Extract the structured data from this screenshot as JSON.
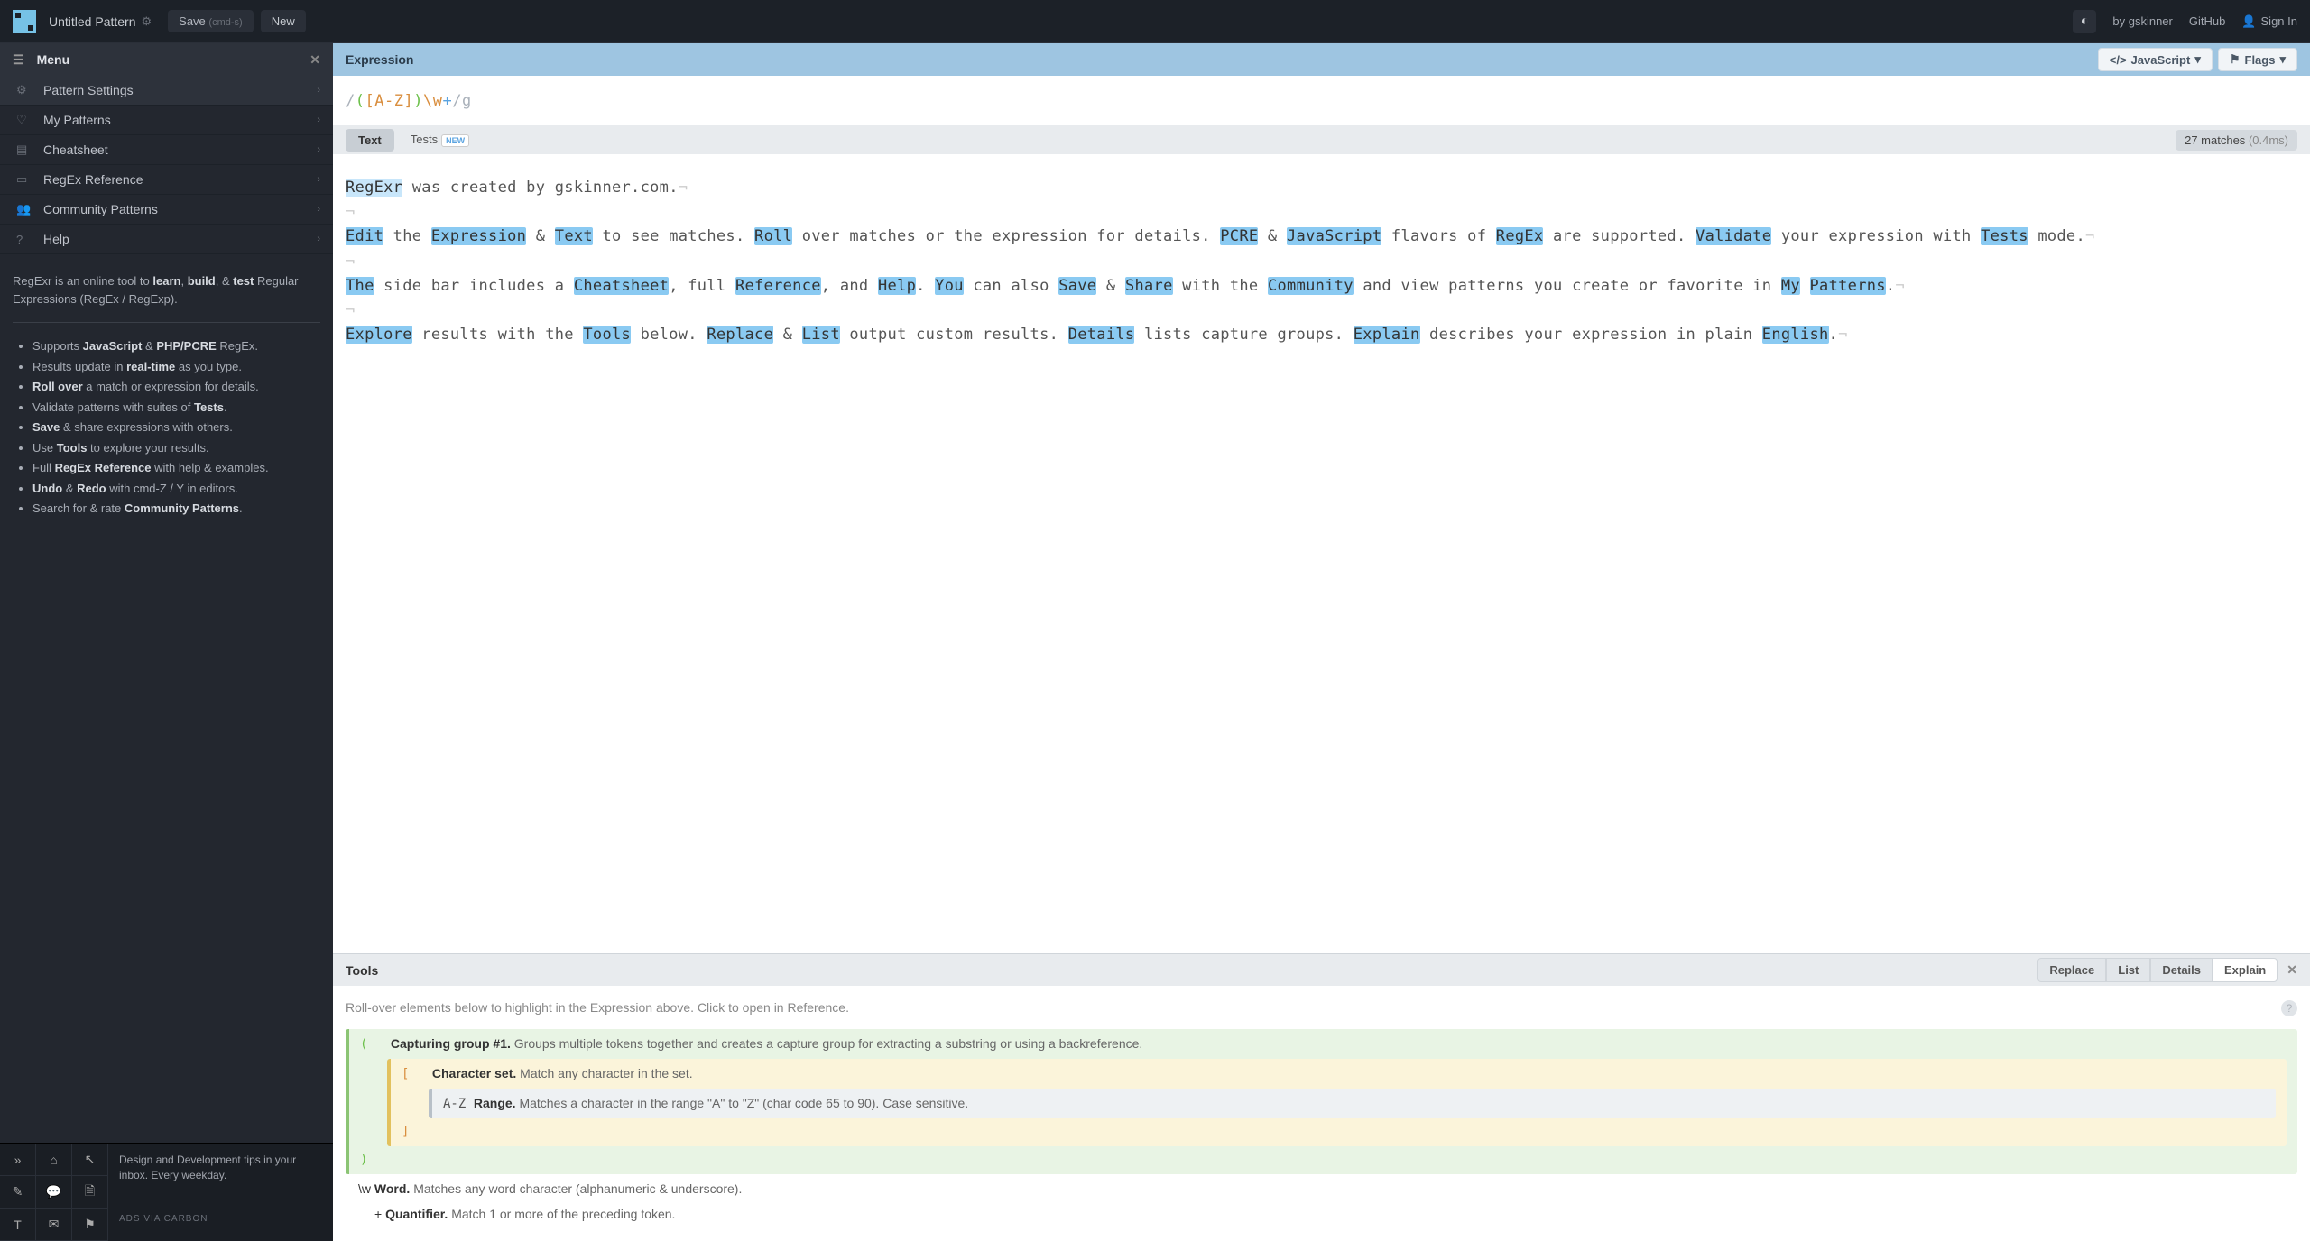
{
  "topbar": {
    "title": "Untitled Pattern",
    "save_label": "Save",
    "save_cmd": "(cmd-s)",
    "new_label": "New",
    "by_label": "by",
    "by_author": "gskinner",
    "github_label": "GitHub",
    "signin_label": "Sign In"
  },
  "sidebar": {
    "menu_title": "Menu",
    "items": [
      {
        "label": "Pattern Settings",
        "icon": "gear"
      },
      {
        "label": "My Patterns",
        "icon": "heart"
      },
      {
        "label": "Cheatsheet",
        "icon": "list"
      },
      {
        "label": "RegEx Reference",
        "icon": "book"
      },
      {
        "label": "Community Patterns",
        "icon": "people"
      },
      {
        "label": "Help",
        "icon": "q"
      }
    ],
    "intro_pre": "RegExr is an online tool to ",
    "intro_bold1": "learn",
    "intro_mid1": ", ",
    "intro_bold2": "build",
    "intro_mid2": ", & ",
    "intro_bold3": "test",
    "intro_post": " Regular Expressions (RegEx / RegExp).",
    "bullets": [
      {
        "pre": "Supports ",
        "b1": "JavaScript",
        "mid": " & ",
        "b2": "PHP/PCRE",
        "post": " RegEx."
      },
      {
        "pre": "Results update in ",
        "b1": "real-time",
        "post": " as you type."
      },
      {
        "b1": "Roll over",
        "post": " a match or expression for details."
      },
      {
        "pre": "Validate patterns with suites of ",
        "b1": "Tests",
        "post": "."
      },
      {
        "b1": "Save",
        "post": " & share expressions with others."
      },
      {
        "pre": "Use ",
        "b1": "Tools",
        "post": " to explore your results."
      },
      {
        "pre": "Full ",
        "b1": "RegEx Reference",
        "post": " with help & examples."
      },
      {
        "b1": "Undo",
        "mid": " & ",
        "b2": "Redo",
        "post": " with cmd-Z / Y in editors."
      },
      {
        "pre": "Search for & rate ",
        "b1": "Community Patterns",
        "post": "."
      }
    ],
    "ad_text": "Design and Development tips in your inbox. Every weekday.",
    "ad_via": "ADS VIA CARBON"
  },
  "expression": {
    "header": "Expression",
    "flavor_label": "JavaScript",
    "flags_label": "Flags",
    "pattern_open": "/",
    "pattern_paren_open": "(",
    "pattern_bracket_open": "[",
    "pattern_range": "A-Z",
    "pattern_bracket_close": "]",
    "pattern_paren_close": ")",
    "pattern_esc": "\\w",
    "pattern_plus": "+",
    "pattern_close": "/",
    "pattern_flags": "g"
  },
  "tabs": {
    "text_label": "Text",
    "tests_label": "Tests",
    "new_badge": "NEW",
    "match_count": "27 matches",
    "match_time": "(0.4ms)"
  },
  "sample_text": {
    "line1_parts": [
      "RegExr",
      " was created by gskinner.com."
    ],
    "line2_parts": [
      "Edit",
      " the ",
      "Expression",
      " & ",
      "Text",
      " to see matches. ",
      "Roll",
      " over matches or the expression for details. ",
      "PCRE",
      " & ",
      "JavaScript",
      " flavors of ",
      "RegEx",
      " are supported. ",
      "Validate",
      " your expression with ",
      "Tests",
      " mode."
    ],
    "line3_parts": [
      "The",
      " side bar includes a ",
      "Cheatsheet",
      ", full ",
      "Reference",
      ", and ",
      "Help",
      ". ",
      "You",
      " can also ",
      "Save",
      " & ",
      "Share",
      " with the ",
      "Community",
      " and view patterns you create or favorite in ",
      "My",
      " ",
      "Patterns",
      "."
    ],
    "line4_parts": [
      "Explore",
      " results with the ",
      "Tools",
      " below. ",
      "Replace",
      " & ",
      "List",
      " output custom results. ",
      "Details",
      " lists capture groups. ",
      "Explain",
      " describes your expression in plain ",
      "English",
      "."
    ]
  },
  "tools": {
    "header": "Tools",
    "tabs": [
      "Replace",
      "List",
      "Details",
      "Explain"
    ],
    "active_tab": "Explain",
    "hint": "Roll-over elements below to highlight in the Expression above. Click to open in Reference.",
    "explain": [
      {
        "token": "(",
        "title": "Capturing group #1.",
        "desc": " Groups multiple tokens together and creates a capture group for extracting a substring or using a backreference.",
        "cls": "green"
      },
      {
        "token": "[",
        "title": "Character set.",
        "desc": " Match any character in the set.",
        "cls": "yellow"
      },
      {
        "token": "A-Z",
        "title": "Range.",
        "desc": " Matches a character in the range \"A\" to \"Z\" (char code 65 to 90). Case sensitive.",
        "cls": "gray"
      },
      {
        "token": "]",
        "title": "",
        "desc": "",
        "cls": "yellow"
      },
      {
        "token": ")",
        "title": "",
        "desc": "",
        "cls": "green"
      },
      {
        "token": "\\w",
        "title": "Word.",
        "desc": " Matches any word character (alphanumeric & underscore).",
        "cls": "blue",
        "tok_cls": "tok-esc"
      },
      {
        "token": "+",
        "title": "Quantifier.",
        "desc": " Match 1 or more of the preceding token.",
        "cls": "blue",
        "tok_cls": "tok-plus"
      }
    ]
  }
}
